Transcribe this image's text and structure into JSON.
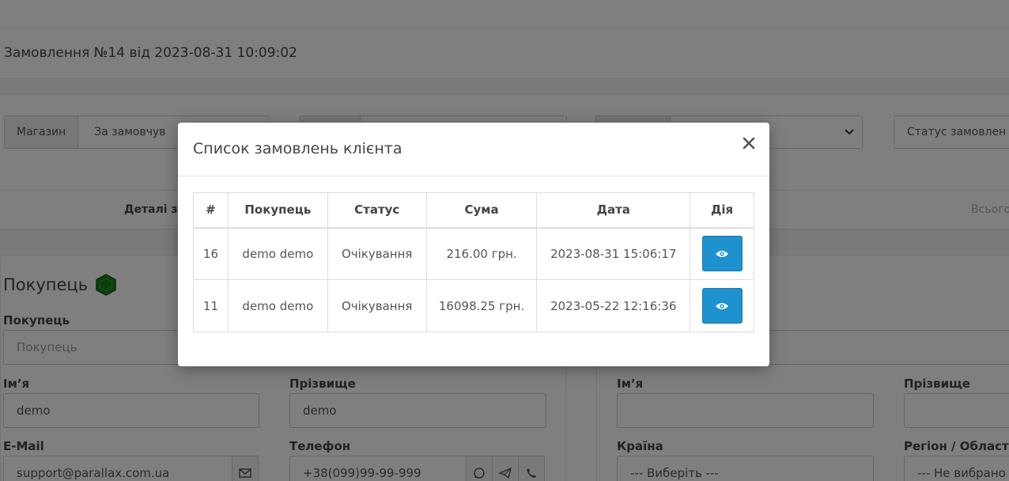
{
  "page": {
    "title": "Замовлення №14 від 2023-08-31 10:09:02",
    "store_label": "Магазин",
    "store_value": "За замовчув",
    "status_value": "Статус замовлен",
    "tab_details": "Деталі з",
    "tab_total": "Всього"
  },
  "customer": {
    "section_title": "Покупець",
    "customer_label": "Покупець",
    "customer_placeholder": "Покупець",
    "firstname_label": "Ім’я",
    "firstname_value": "demo",
    "lastname_label": "Прізвище",
    "lastname_value": "demo",
    "email_label": "E-Mail",
    "email_value": "support@parallax.com.ua",
    "phone_label": "Телефон",
    "phone_value": "+38(099)99-99-999"
  },
  "address": {
    "firstname_label": "Ім’я",
    "lastname_label": "Прізвище",
    "country_label": "Країна",
    "country_value": "--- Виберіть ---",
    "region_label": "Регіон / Област",
    "region_value": "--- Не вибрано"
  },
  "modal": {
    "title": "Список замовлень клієнта",
    "columns": [
      "#",
      "Покупець",
      "Статус",
      "Сума",
      "Дата",
      "Дія"
    ],
    "rows": [
      {
        "id": "16",
        "customer": "demo demo",
        "status": "Очікування",
        "total": "216.00 грн.",
        "date": "2023-08-31 15:06:17"
      },
      {
        "id": "11",
        "customer": "demo demo",
        "status": "Очікування",
        "total": "16098.25 грн.",
        "date": "2023-05-22 12:16:36"
      }
    ]
  },
  "icons": {
    "close": "close-icon",
    "view": "eye-icon",
    "email": "envelope-icon",
    "whatsapp": "whatsapp-icon",
    "telegram": "telegram-icon",
    "phone": "phone-icon",
    "chevron": "chevron-down-icon",
    "status_indicator": "hexagon-icon"
  },
  "colors": {
    "primary_button": "#1e91cf",
    "backdrop": "rgba(0,0,0,0.5)",
    "status_indicator": "#1a7a1a"
  }
}
